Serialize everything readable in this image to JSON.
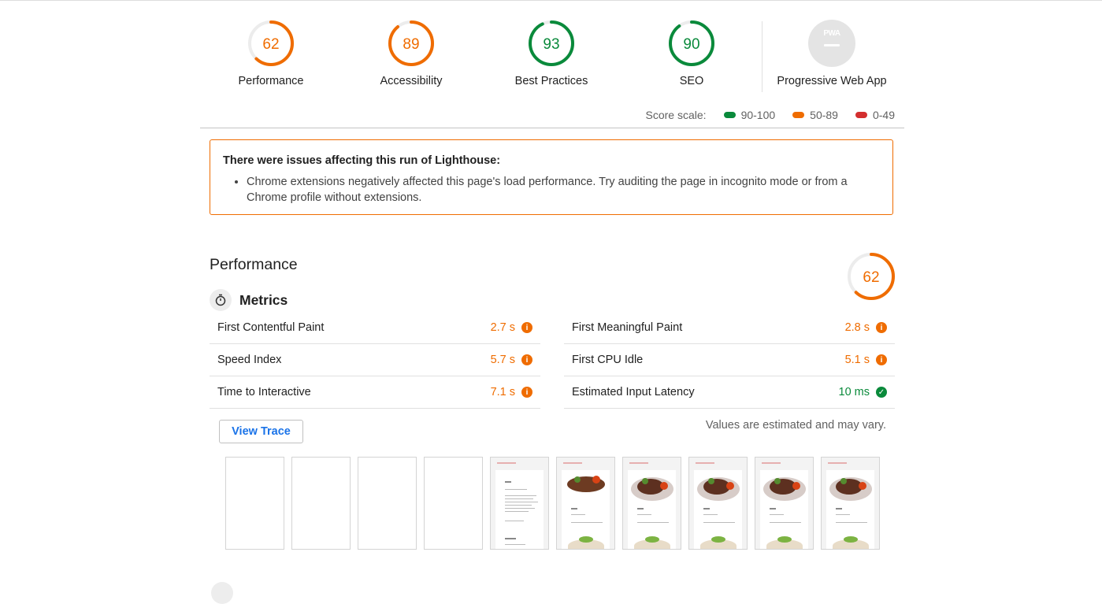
{
  "categories": [
    {
      "label": "Performance",
      "score": "62",
      "value": 62,
      "color": "#ef6c00",
      "track": "#fde8d6"
    },
    {
      "label": "Accessibility",
      "score": "89",
      "value": 89,
      "color": "#ef6c00",
      "track": "#fde8d6"
    },
    {
      "label": "Best Practices",
      "score": "93",
      "value": 93,
      "color": "#0a8a3b",
      "track": "#d4eedd"
    },
    {
      "label": "SEO",
      "score": "90",
      "value": 90,
      "color": "#0a8a3b",
      "track": "#d4eedd"
    }
  ],
  "pwa": {
    "label": "Progressive Web App",
    "badge_text": "PWA"
  },
  "score_scale": {
    "label": "Score scale:",
    "items": [
      {
        "range": "90-100",
        "color": "#0a8a3b"
      },
      {
        "range": "50-89",
        "color": "#ef6c00"
      },
      {
        "range": "0-49",
        "color": "#d32f2f"
      }
    ]
  },
  "warning": {
    "title": "There were issues affecting this run of Lighthouse:",
    "items": [
      "Chrome extensions negatively affected this page's load performance. Try auditing the page in incognito mode or from a Chrome profile without extensions."
    ]
  },
  "performance": {
    "title": "Performance",
    "score": "62",
    "value": 62,
    "metrics_title": "Metrics",
    "metrics_left": [
      {
        "label": "First Contentful Paint",
        "value": "2.7 s",
        "status": "avg"
      },
      {
        "label": "Speed Index",
        "value": "5.7 s",
        "status": "avg"
      },
      {
        "label": "Time to Interactive",
        "value": "7.1 s",
        "status": "avg"
      }
    ],
    "metrics_right": [
      {
        "label": "First Meaningful Paint",
        "value": "2.8 s",
        "status": "avg"
      },
      {
        "label": "First CPU Idle",
        "value": "5.1 s",
        "status": "avg"
      },
      {
        "label": "Estimated Input Latency",
        "value": "10 ms",
        "status": "pass"
      }
    ],
    "view_trace": "View Trace",
    "disclaimer": "Values are estimated and may vary.",
    "filmstrip": [
      "blank",
      "blank",
      "blank",
      "blank",
      "text",
      "food",
      "food",
      "food",
      "food",
      "food"
    ]
  },
  "icons": {
    "metrics": "stopwatch-icon",
    "average": "info-icon",
    "pass": "check-icon"
  }
}
